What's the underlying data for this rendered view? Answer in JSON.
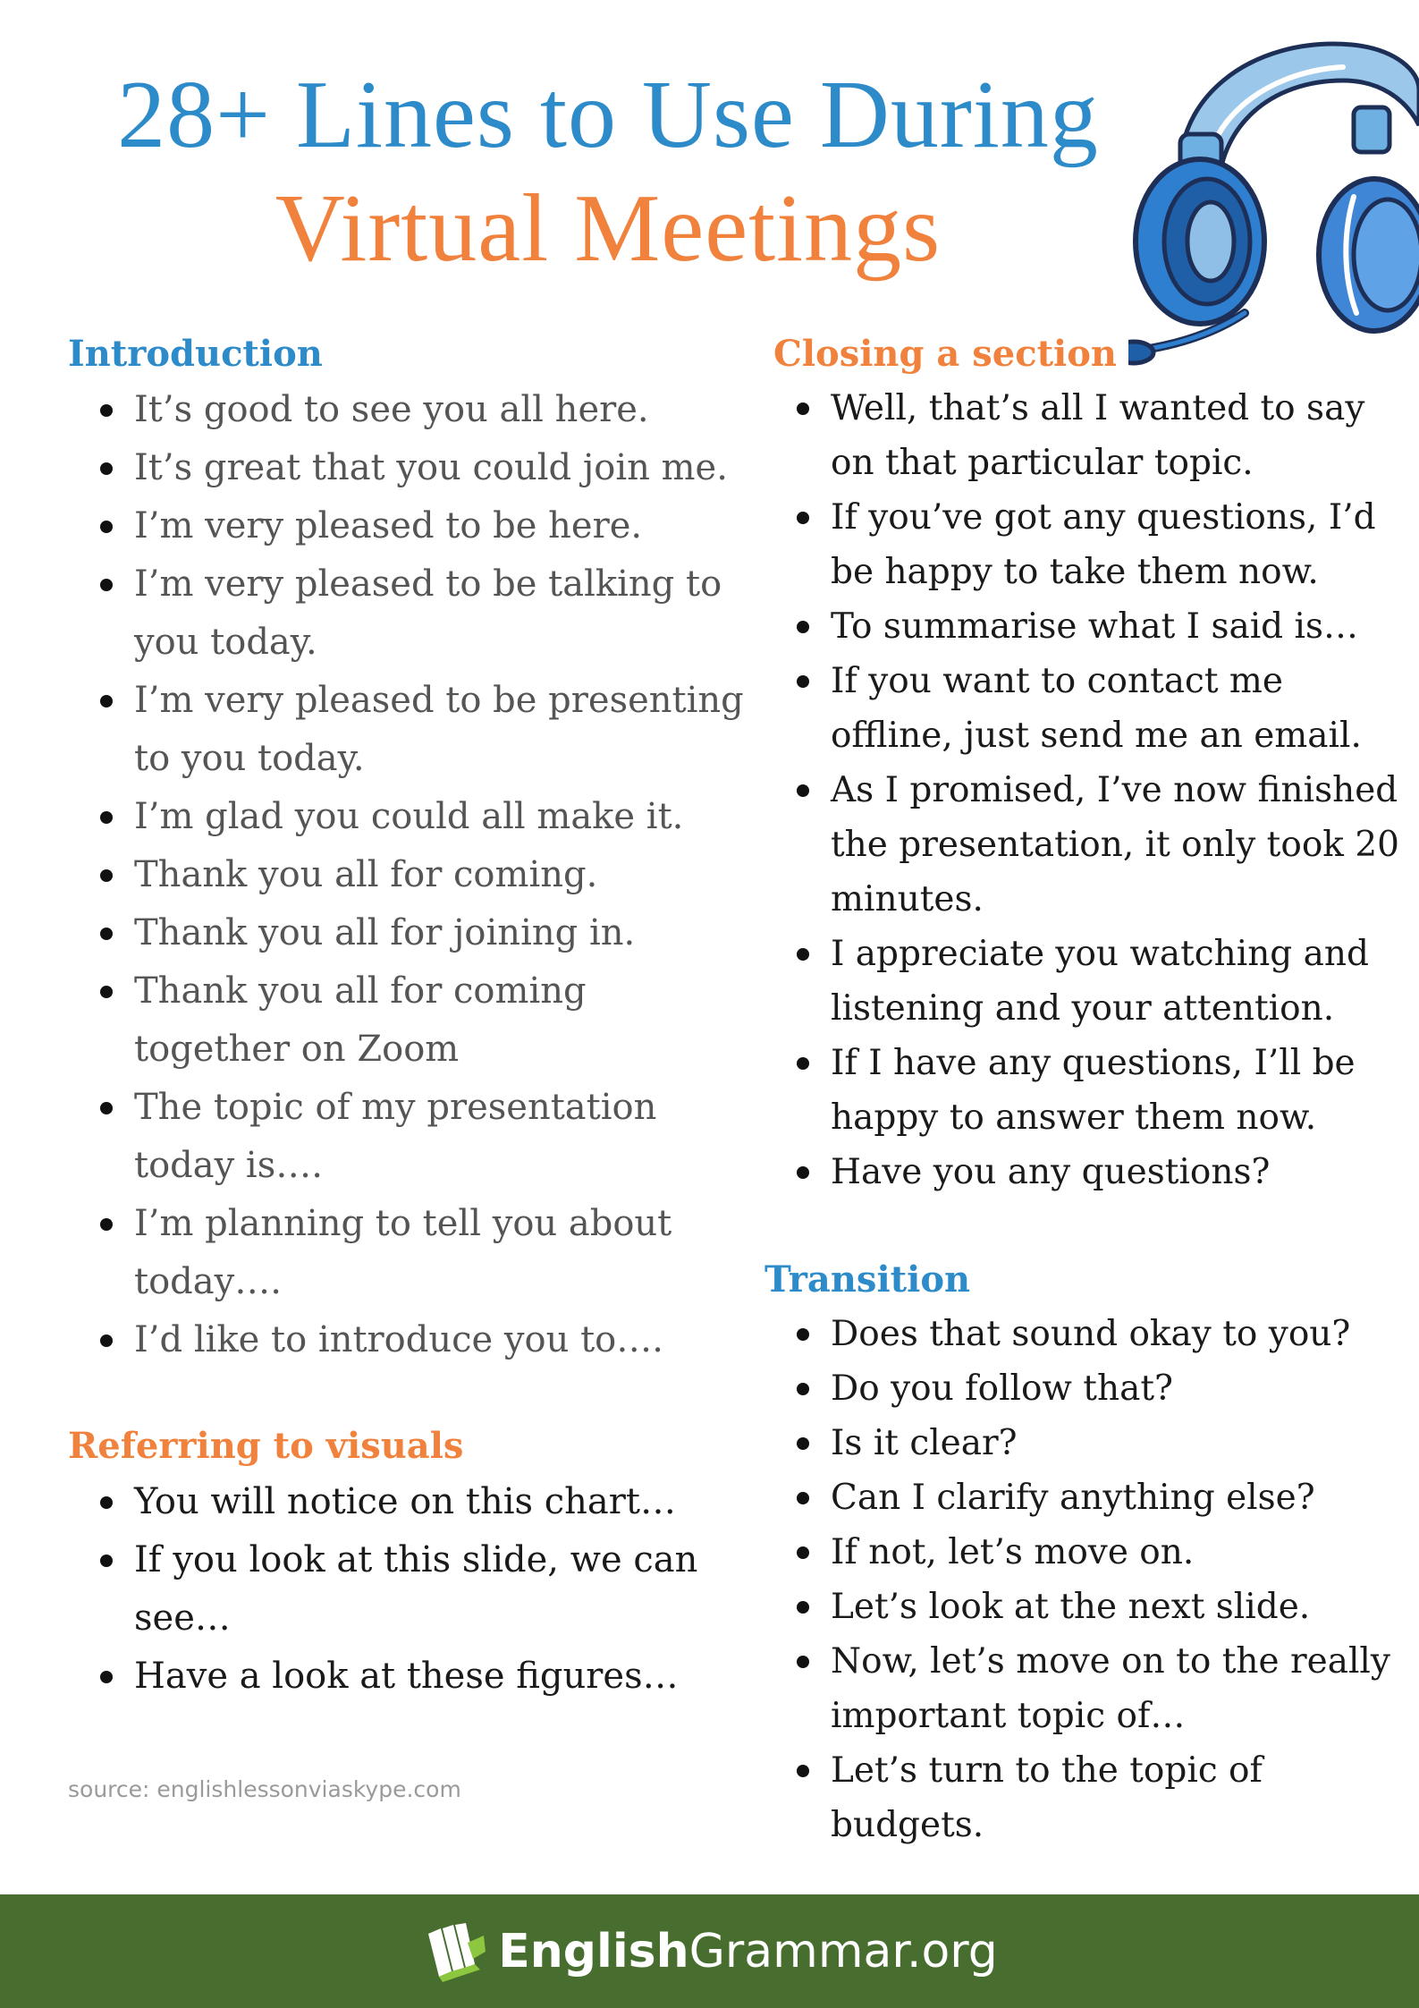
{
  "title": {
    "line1": "28+ Lines to Use During",
    "line2": "Virtual Meetings"
  },
  "sections": {
    "introduction": {
      "heading": "Introduction",
      "items": [
        "It’s good to see you all here.",
        "It’s great that you could join me.",
        "I’m very pleased to be here.",
        "I’m very pleased to be talking to you today.",
        "I’m very pleased to be presenting to you today.",
        "I’m glad you could all make it.",
        "Thank you all for coming.",
        "Thank you all for joining in.",
        "Thank you all for coming together on Zoom",
        "The topic of my presentation today is….",
        "I’m planning to tell you about today….",
        "I’d like to introduce you to…."
      ]
    },
    "visuals": {
      "heading": "Referring to visuals",
      "items": [
        "You will notice on this chart…",
        "If you look at this slide, we can see…",
        "Have a look at these figures…"
      ]
    },
    "closing": {
      "heading": "Closing a section",
      "items": [
        "Well, that’s all I wanted to say on that particular topic.",
        "If you’ve got any questions, I’d be happy to take them now.",
        "To summarise what I said is…",
        "If you want to contact me offline, just send me an email.",
        "As I promised, I’ve now finished the presentation, it only took 20 minutes.",
        "I appreciate you watching and listening and your attention.",
        "If I have any questions, I’ll be happy to answer them now.",
        "Have you any questions?"
      ]
    },
    "transition": {
      "heading": "Transition",
      "items": [
        "Does that sound okay to you?",
        "Do you follow that?",
        "Is it clear?",
        "Can I clarify anything else?",
        "If not, let’s move on.",
        "Let’s look at the next slide.",
        "Now, let’s move on to the really important topic of…",
        "Let’s turn to the topic of budgets."
      ]
    }
  },
  "source": "source: englishlessonviaskype.com",
  "footer": {
    "brand_bold": "English",
    "brand_regular": "Grammar.org",
    "logo_icon": "books-icon",
    "background": "#476e2f"
  },
  "colors": {
    "blue": "#2e8bc9",
    "orange": "#f0823d"
  },
  "illustration": "headset-icon"
}
